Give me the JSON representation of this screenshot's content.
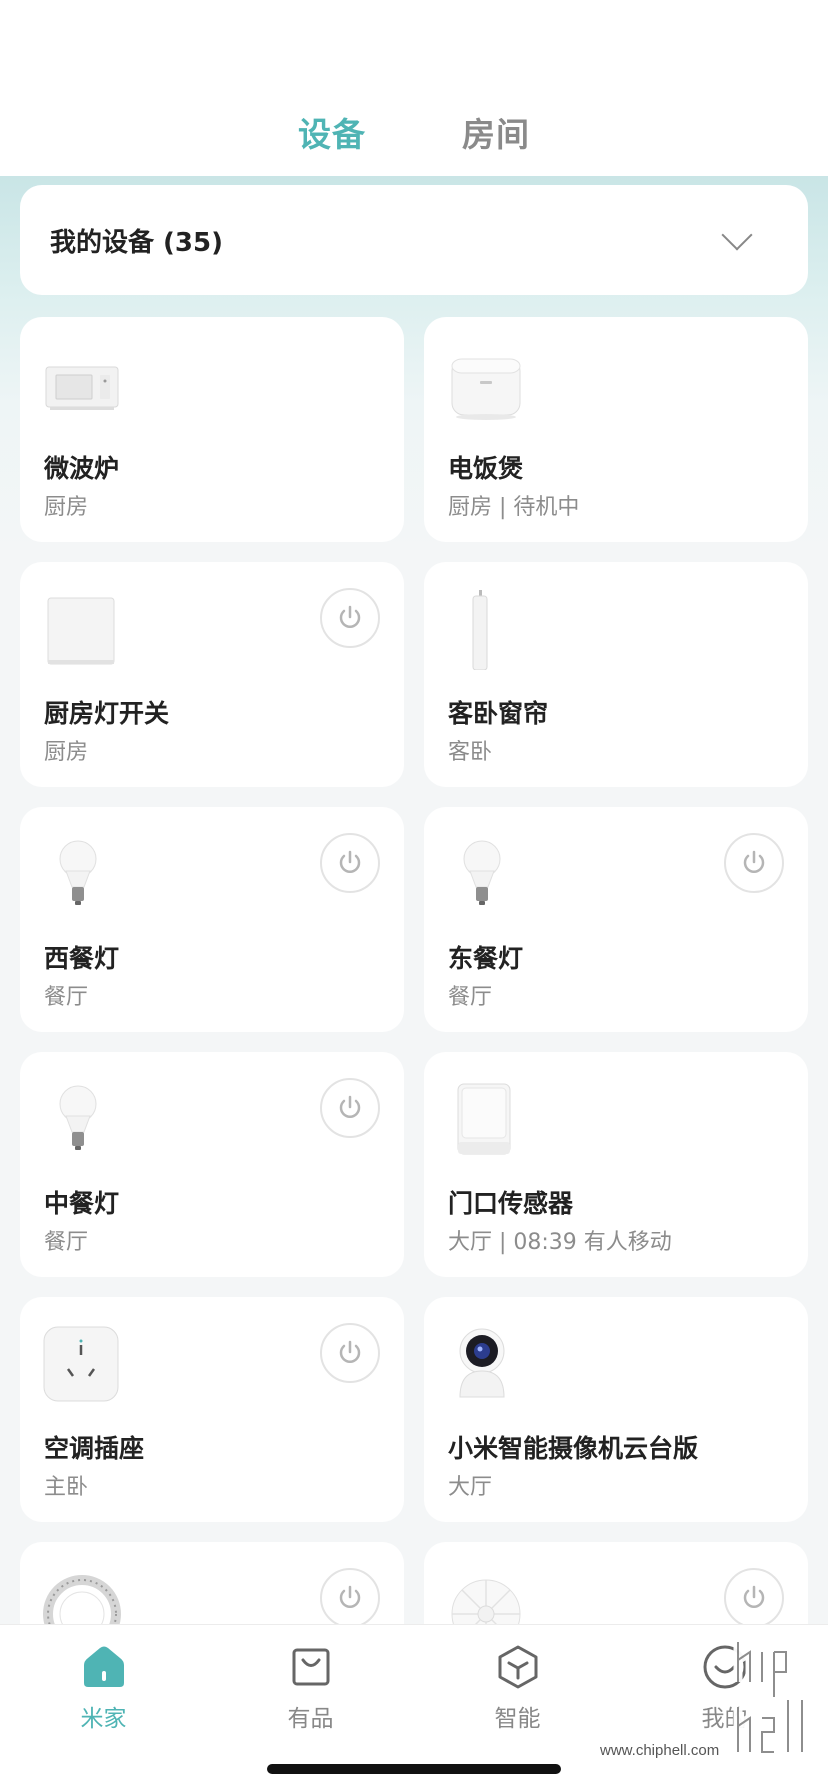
{
  "header": {
    "tabs": [
      {
        "label": "设备",
        "active": true
      },
      {
        "label": "房间",
        "active": false
      }
    ]
  },
  "selector": {
    "label": "我的设备 (35)"
  },
  "devices": [
    {
      "name": "微波炉",
      "sub": "厨房",
      "icon": "microwave-icon",
      "power": false
    },
    {
      "name": "电饭煲",
      "sub": "厨房 | 待机中",
      "icon": "rice-cooker-icon",
      "power": false
    },
    {
      "name": "厨房灯开关",
      "sub": "厨房",
      "icon": "wall-switch-icon",
      "power": true
    },
    {
      "name": "客卧窗帘",
      "sub": "客卧",
      "icon": "curtain-motor-icon",
      "power": false
    },
    {
      "name": "西餐灯",
      "sub": "餐厅",
      "icon": "bulb-icon",
      "power": true
    },
    {
      "name": "东餐灯",
      "sub": "餐厅",
      "icon": "bulb-icon",
      "power": true
    },
    {
      "name": "中餐灯",
      "sub": "餐厅",
      "icon": "bulb-icon",
      "power": true
    },
    {
      "name": "门口传感器",
      "sub": "大厅 | 08:39 有人移动",
      "icon": "motion-sensor-icon",
      "power": false
    },
    {
      "name": "空调插座",
      "sub": "主卧",
      "icon": "smart-plug-icon",
      "power": true
    },
    {
      "name": "小米智能摄像机云台版",
      "sub": "大厅",
      "icon": "camera-icon",
      "power": false
    },
    {
      "name": "",
      "sub": "",
      "icon": "light-strip-icon",
      "power": true
    },
    {
      "name": "",
      "sub": "",
      "icon": "fan-icon",
      "power": true
    }
  ],
  "bottom_nav": [
    {
      "label": "米家",
      "icon": "home-icon",
      "active": true
    },
    {
      "label": "有品",
      "icon": "shopping-bag-icon",
      "active": false
    },
    {
      "label": "智能",
      "icon": "cube-icon",
      "active": false
    },
    {
      "label": "我的",
      "icon": "profile-icon",
      "active": false
    }
  ],
  "watermark": {
    "text": "chiphell",
    "url": "www.chiphell.com"
  },
  "colors": {
    "accent": "#4fb4b4",
    "muted": "#8c8c8c"
  }
}
